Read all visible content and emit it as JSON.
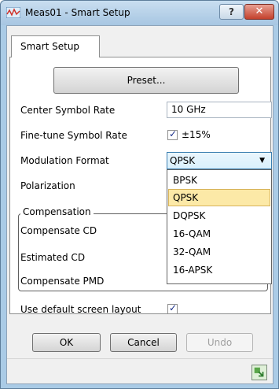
{
  "window": {
    "title": "Meas01 - Smart Setup",
    "help_label": "?",
    "close_label": "✕"
  },
  "tab": {
    "label": "Smart Setup"
  },
  "preset": {
    "label": "Preset..."
  },
  "fields": {
    "center_symbol_rate": {
      "label": "Center Symbol Rate",
      "value": "10 GHz"
    },
    "fine_tune": {
      "label": "Fine-tune Symbol Rate",
      "checked": true,
      "checkbox_text": "±15%"
    },
    "modulation_format": {
      "label": "Modulation Format",
      "value": "QPSK"
    },
    "polarization": {
      "label": "Polarization"
    }
  },
  "compensation": {
    "title": "Compensation",
    "compensate_cd": "Compensate CD",
    "estimated_cd": "Estimated CD",
    "compensate_pmd": "Compensate PMD"
  },
  "dropdown": {
    "options": [
      "BPSK",
      "QPSK",
      "DQPSK",
      "16-QAM",
      "32-QAM",
      "16-APSK"
    ],
    "selected": "QPSK"
  },
  "default_layout": {
    "label": "Use default screen layout",
    "checked": true
  },
  "buttons": {
    "ok": "OK",
    "cancel": "Cancel",
    "undo": "Undo"
  },
  "colors": {
    "highlight": "#fce9a7",
    "titlebar": "#aacbe6"
  }
}
